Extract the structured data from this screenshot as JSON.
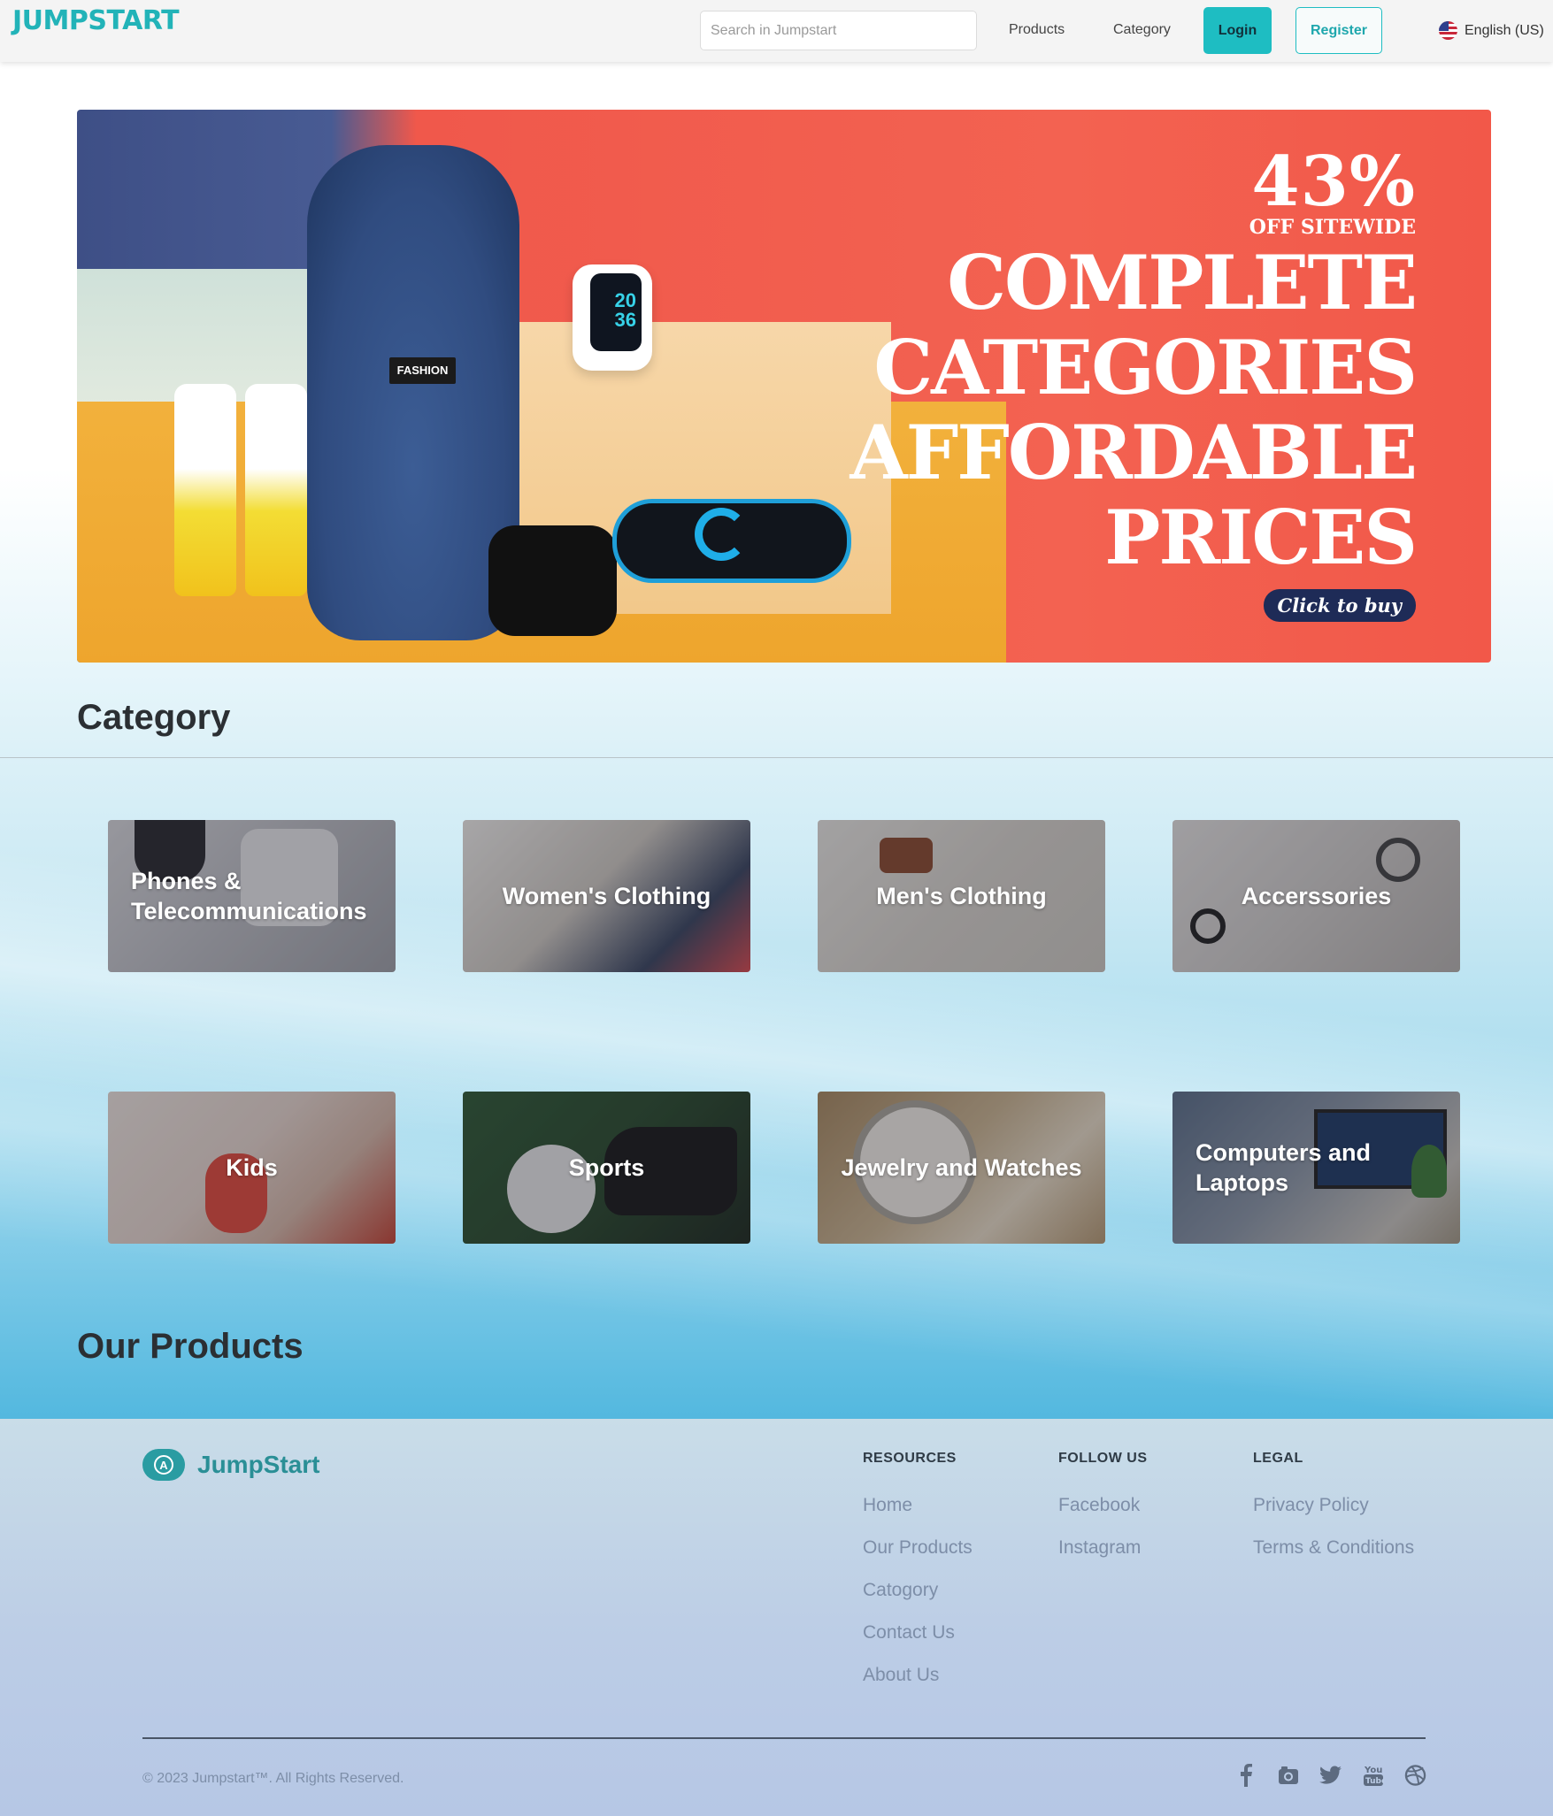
{
  "header": {
    "logo_text": "JUMPSTART",
    "search": {
      "placeholder": "Search in Jumpstart",
      "value": ""
    },
    "nav": [
      {
        "label": "Products"
      },
      {
        "label": "Category"
      }
    ],
    "login_label": "Login",
    "register_label": "Register",
    "language_label": "English (US)",
    "accent_color": "#1ebdc2"
  },
  "hero": {
    "discount": "43%",
    "discount_sub": "OFF SITEWIDE",
    "headline": [
      "COMPLETE",
      "CATEGORIES",
      "AFFORDABLE",
      "PRICES"
    ],
    "cta_label": "Click to buy",
    "product_tag": "FASHION",
    "watch_display": "20\n36"
  },
  "category_section": {
    "title": "Category",
    "items": [
      {
        "label": "Phones & Telecommunications"
      },
      {
        "label": "Women's Clothing"
      },
      {
        "label": "Men's Clothing"
      },
      {
        "label": "Accerssories"
      },
      {
        "label": "Kids"
      },
      {
        "label": "Sports"
      },
      {
        "label": "Jewelry and Watches"
      },
      {
        "label": "Computers and Laptops"
      }
    ]
  },
  "products_section": {
    "title": "Our Products"
  },
  "footer": {
    "brand": "JumpStart",
    "columns": [
      {
        "title": "RESOURCES",
        "links": [
          "Home",
          "Our Products",
          "Catogory",
          "Contact Us",
          "About Us"
        ]
      },
      {
        "title": "FOLLOW US",
        "links": [
          "Facebook",
          "Instagram"
        ]
      },
      {
        "title": "LEGAL",
        "links": [
          "Privacy Policy",
          "Terms & Conditions"
        ]
      }
    ],
    "copyright": "© 2023 Jumpstart™. All Rights Reserved.",
    "social_icons": [
      "facebook-icon",
      "instagram-icon",
      "twitter-icon",
      "youtube-icon",
      "dribbble-icon"
    ]
  }
}
